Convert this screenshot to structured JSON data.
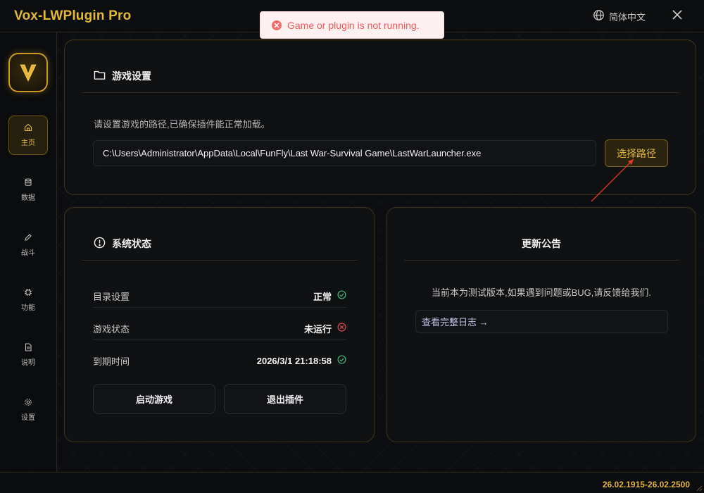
{
  "app": {
    "title": "Vox-LWPlugin Pro"
  },
  "header": {
    "language": "简体中文"
  },
  "toast": {
    "message": "Game or plugin is not running."
  },
  "sidebar": {
    "items": [
      {
        "label": "主页",
        "icon": "home-icon"
      },
      {
        "label": "数据",
        "icon": "database-icon"
      },
      {
        "label": "战斗",
        "icon": "pen-icon"
      },
      {
        "label": "功能",
        "icon": "chip-icon"
      },
      {
        "label": "说明",
        "icon": "document-icon"
      },
      {
        "label": "设置",
        "icon": "gear-icon"
      }
    ]
  },
  "game_settings": {
    "title": "游戏设置",
    "description": "请设置游戏的路径,已确保插件能正常加载。",
    "path_value": "C:\\Users\\Administrator\\AppData\\Local\\FunFly\\Last War-Survival Game\\LastWarLauncher.exe",
    "choose_button": "选择路径"
  },
  "system_status": {
    "title": "系统状态",
    "rows": [
      {
        "label": "目录设置",
        "value": "正常",
        "status": "ok"
      },
      {
        "label": "游戏状态",
        "value": "未运行",
        "status": "error"
      },
      {
        "label": "到期时间",
        "value": "2026/3/1 21:18:58",
        "status": "ok"
      }
    ],
    "start_button": "启动游戏",
    "exit_button": "退出插件"
  },
  "announcement": {
    "title": "更新公告",
    "text": "当前本为测试版本,如果遇到问题或BUG,请反馈给我们.",
    "log_link": "查看完整日志 →"
  },
  "statusbar": {
    "version": "26.02.1915-26.02.2500"
  },
  "colors": {
    "accent": "#e2b93b",
    "ok": "#3fbf7f",
    "error": "#e5484d",
    "toast_text": "#f0595c"
  }
}
